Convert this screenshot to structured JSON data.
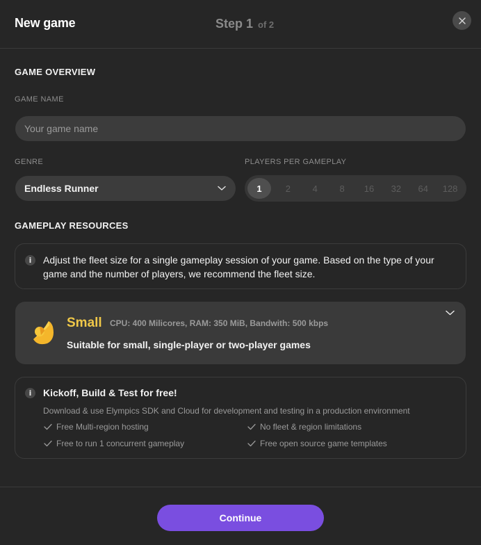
{
  "header": {
    "title": "New game",
    "step_label": "Step 1",
    "step_of": "of 2",
    "close_icon": "close-icon"
  },
  "overview": {
    "section_title": "GAME OVERVIEW",
    "game_name_label": "GAME NAME",
    "game_name_value": "",
    "game_name_placeholder": "Your game name",
    "genre_label": "GENRE",
    "genre_value": "Endless Runner",
    "players_label": "PLAYERS PER GAMEPLAY",
    "players_options": [
      "1",
      "2",
      "4",
      "8",
      "16",
      "32",
      "64",
      "128"
    ],
    "players_selected": "1"
  },
  "resources": {
    "section_title": "GAMEPLAY RESOURCES",
    "info_text": "Adjust the fleet size for a single gameplay session of your game. Based on the type of your game and the number of players, we recommend the fleet size.",
    "fleet": {
      "name": "Small",
      "specs": "CPU: 400 Milicores, RAM: 350 MiB, Bandwith: 500 kbps",
      "description": "Suitable for small, single-player or two-player games",
      "accent_color": "#f0c849"
    }
  },
  "free_tier": {
    "title": "Kickoff, Build & Test for free!",
    "description": "Download & use Elympics SDK and Cloud for development and testing in a production environment",
    "features": [
      "Free Multi-region hosting",
      "No fleet & region limitations",
      "Free to run 1 concurrent gameplay",
      "Free open source game templates"
    ]
  },
  "footer": {
    "continue_label": "Continue",
    "accent_color": "#7a4ee0"
  }
}
